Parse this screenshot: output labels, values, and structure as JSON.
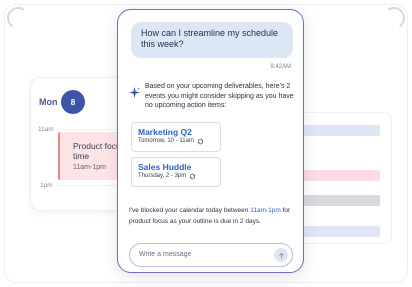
{
  "calendar": {
    "day_label": "Mon",
    "date": "8",
    "time_11am": "11am",
    "time_1pm": "1pm",
    "event": {
      "title": "Product focus time",
      "time": "11am-1pm"
    }
  },
  "chat": {
    "user_message": "How can I streamline my schedule this week?",
    "timestamp": "9:42AM",
    "ai_intro": "Based on your upcoming deliverables, here's 2 events you might consider skipping as you have no upcoming action items:",
    "suggestions": [
      {
        "title": "Marketing Q2",
        "time": "Tomorrow, 10 - 11am",
        "icon": "recurring-icon"
      },
      {
        "title": "Sales Huddle",
        "time": "Thursday, 2 - 3pm",
        "icon": "recurring-icon"
      }
    ],
    "final_message": {
      "before": "I've blocked your calendar today between ",
      "highlight": "11am-1pm",
      "after": " for product focus as your outline is due in 2 days."
    },
    "input": {
      "placeholder": "Write a message"
    }
  },
  "colors": {
    "accent": "#3f53a8",
    "link_blue": "#2f61c9",
    "panel_border": "#6d6fc2",
    "user_bubble": "#dde6f5",
    "event_bg": "#fde4e6",
    "event_border": "#e8858e",
    "bar_blue": "#dfe7f6",
    "bar_pink": "#fbdde3",
    "bar_gray": "#d8d9de"
  },
  "background_bars": [
    {
      "color": "#dfe7f6"
    },
    {
      "color": "#fbdde3"
    },
    {
      "color": "#d8d9de"
    },
    {
      "color": "#dfe7f6"
    }
  ]
}
